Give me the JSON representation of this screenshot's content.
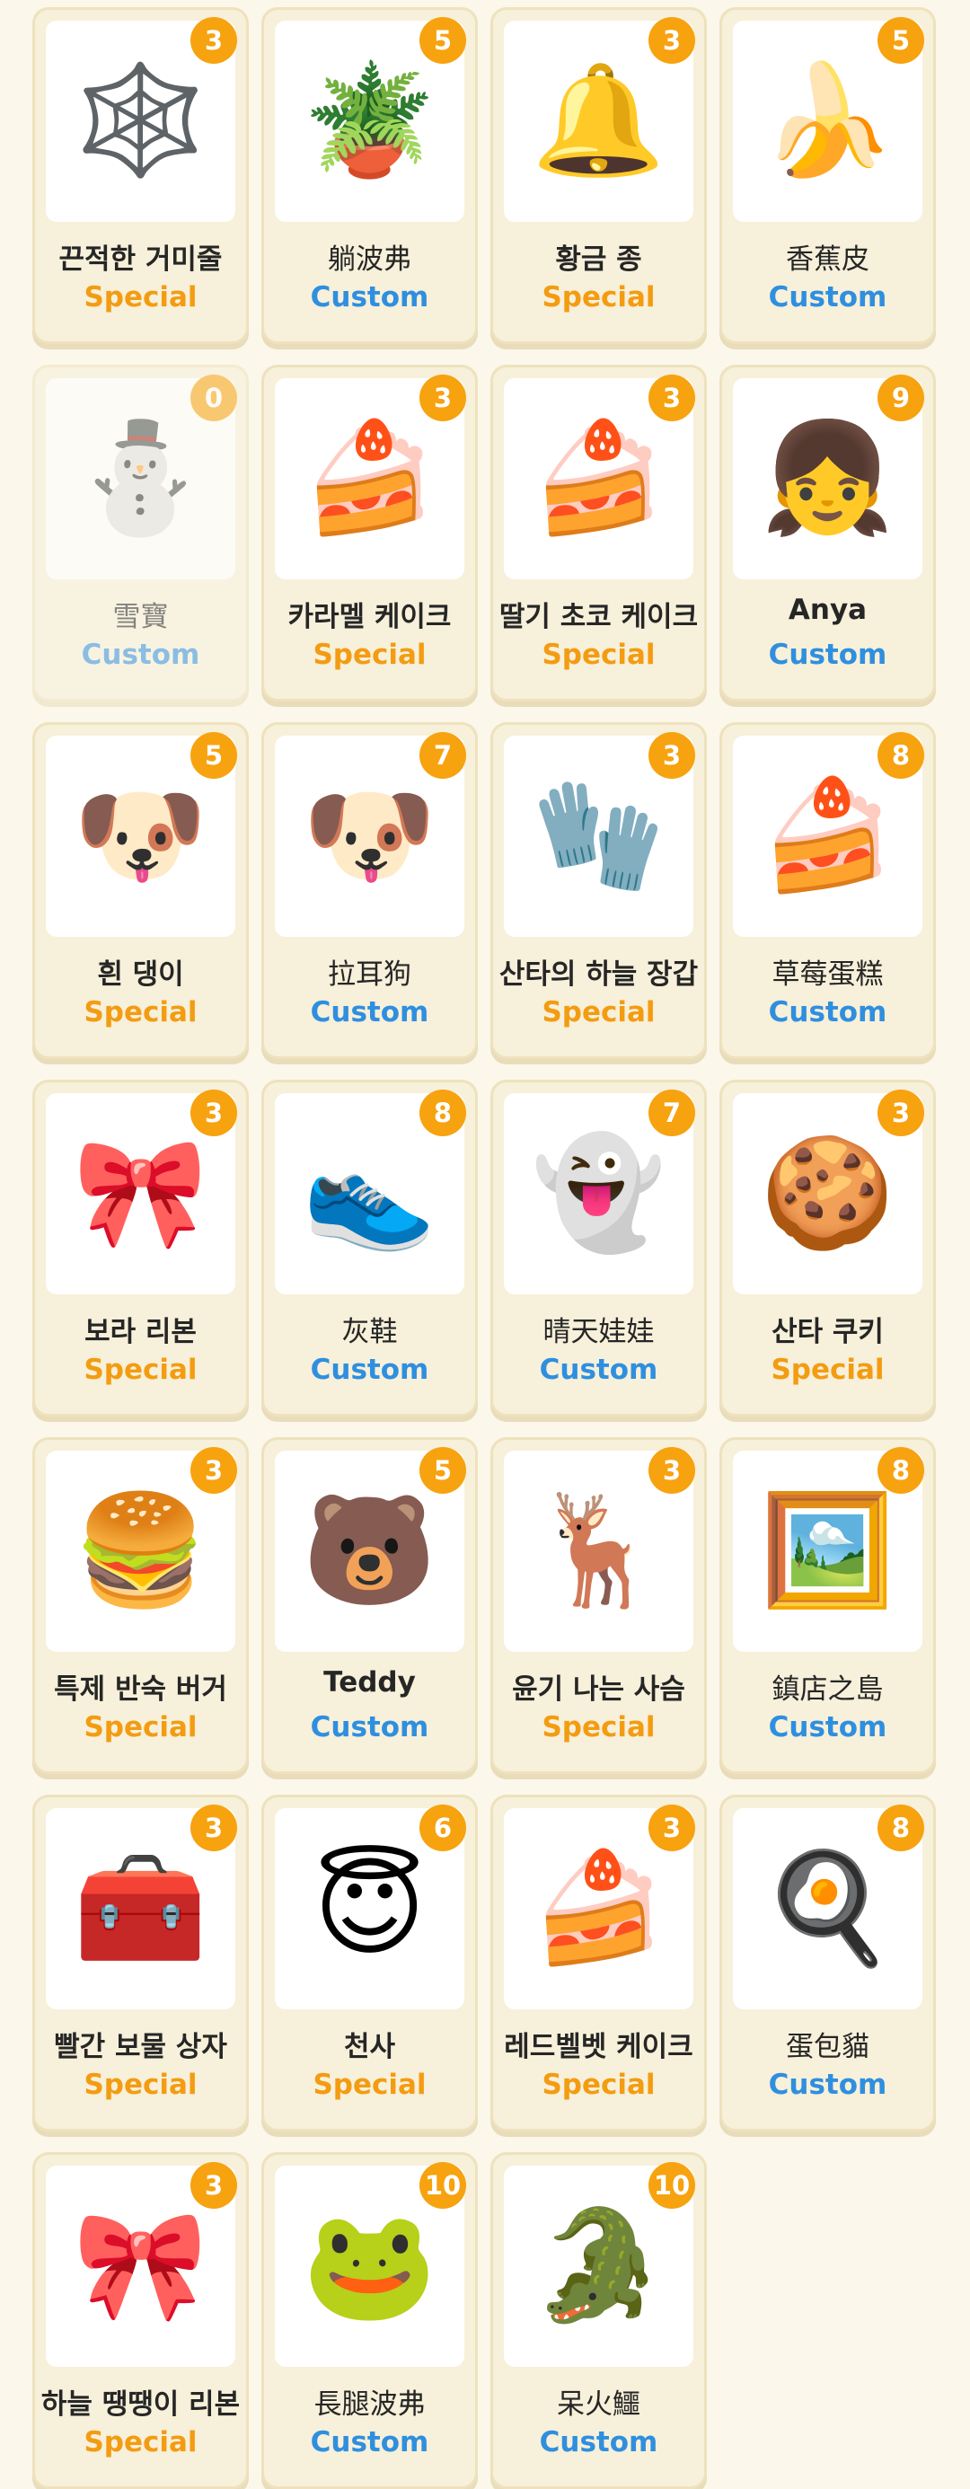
{
  "colors": {
    "special": "#f39c12",
    "custom": "#2f8fdf",
    "badge": "#f7a20f",
    "card_background": "#f7f0da",
    "page_background": "#fbf7ea"
  },
  "items": [
    {
      "name": "끈적한 거미줄",
      "category": "Special",
      "count": "3",
      "icon": "spider-web-icon",
      "glyph": "🕸️"
    },
    {
      "name": "躺波弗",
      "category": "Custom",
      "count": "5",
      "icon": "green-creature-pot-icon",
      "glyph": "🪴"
    },
    {
      "name": "황금 종",
      "category": "Special",
      "count": "3",
      "icon": "golden-bell-icon",
      "glyph": "🔔"
    },
    {
      "name": "香蕉皮",
      "category": "Custom",
      "count": "5",
      "icon": "banana-peel-icon",
      "glyph": "🍌"
    },
    {
      "name": "雪寶",
      "category": "Custom",
      "count": "0",
      "icon": "snowman-icon",
      "glyph": "⛄"
    },
    {
      "name": "카라멜 케이크",
      "category": "Special",
      "count": "3",
      "icon": "caramel-cake-icon",
      "glyph": "🍰"
    },
    {
      "name": "딸기 초코 케이크",
      "category": "Special",
      "count": "3",
      "icon": "strawberry-choco-cake-icon",
      "glyph": "🍰"
    },
    {
      "name": "Anya",
      "category": "Custom",
      "count": "9",
      "icon": "anya-face-icon",
      "glyph": "👧"
    },
    {
      "name": "흰 댕이",
      "category": "Special",
      "count": "5",
      "icon": "white-puppy-icon",
      "glyph": "🐶"
    },
    {
      "name": "拉耳狗",
      "category": "Custom",
      "count": "7",
      "icon": "blue-dog-icon",
      "glyph": "🐶"
    },
    {
      "name": "산타의 하늘 장갑",
      "category": "Special",
      "count": "3",
      "icon": "blue-mitten-icon",
      "glyph": "🧤"
    },
    {
      "name": "草莓蛋糕",
      "category": "Custom",
      "count": "8",
      "icon": "strawberry-cake-icon",
      "glyph": "🍰"
    },
    {
      "name": "보라 리본",
      "category": "Special",
      "count": "3",
      "icon": "purple-ribbon-icon",
      "glyph": "🎀"
    },
    {
      "name": "灰鞋",
      "category": "Custom",
      "count": "8",
      "icon": "grey-shoes-icon",
      "glyph": "👟"
    },
    {
      "name": "晴天娃娃",
      "category": "Custom",
      "count": "7",
      "icon": "teru-teru-bozu-icon",
      "glyph": "👻"
    },
    {
      "name": "산타 쿠키",
      "category": "Special",
      "count": "3",
      "icon": "gingerbread-santa-icon",
      "glyph": "🍪"
    },
    {
      "name": "특제 반숙 버거",
      "category": "Special",
      "count": "3",
      "icon": "egg-burger-icon",
      "glyph": "🍔"
    },
    {
      "name": "Teddy",
      "category": "Custom",
      "count": "5",
      "icon": "teddy-bear-icon",
      "glyph": "🐻"
    },
    {
      "name": "윤기 나는 사슴",
      "category": "Special",
      "count": "3",
      "icon": "deer-icon",
      "glyph": "🦌"
    },
    {
      "name": "鎮店之島",
      "category": "Custom",
      "count": "8",
      "icon": "poster-icon",
      "glyph": "🖼️"
    },
    {
      "name": "빨간 보물 상자",
      "category": "Special",
      "count": "3",
      "icon": "treasure-chest-icon",
      "glyph": "🧰"
    },
    {
      "name": "천사",
      "category": "Special",
      "count": "6",
      "icon": "angel-face-icon",
      "glyph": "😇"
    },
    {
      "name": "레드벨벳 케이크",
      "category": "Special",
      "count": "3",
      "icon": "red-velvet-cake-icon",
      "glyph": "🍰"
    },
    {
      "name": "蛋包貓",
      "category": "Custom",
      "count": "8",
      "icon": "omelette-cat-icon",
      "glyph": "🍳"
    },
    {
      "name": "하늘 땡땡이 리본",
      "category": "Special",
      "count": "3",
      "icon": "blue-dotted-ribbon-icon",
      "glyph": "🎀"
    },
    {
      "name": "長腿波弗",
      "category": "Custom",
      "count": "10",
      "icon": "green-long-leg-creature-icon",
      "glyph": "🐸"
    },
    {
      "name": "呆火鱷",
      "category": "Custom",
      "count": "10",
      "icon": "fire-crocodile-icon",
      "glyph": "🐊"
    }
  ]
}
